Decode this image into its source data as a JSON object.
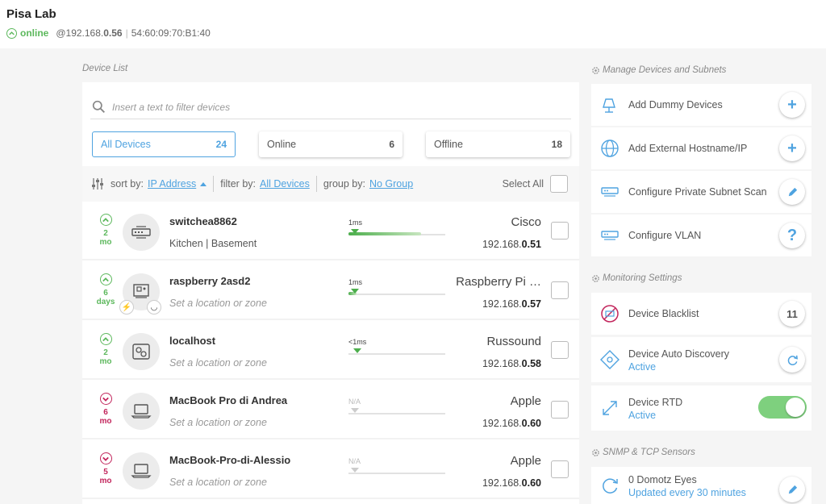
{
  "header": {
    "agent_name": "Pisa Lab",
    "status": "online",
    "ip_prefix": "@192.168.",
    "ip_suffix": "0.56",
    "mac": "54:60:09:70:B1:40"
  },
  "device_list": {
    "title": "Device List",
    "search_placeholder": "Insert a text to filter devices",
    "filters": [
      {
        "label": "All Devices",
        "count": "24"
      },
      {
        "label": "Online",
        "count": "6"
      },
      {
        "label": "Offline",
        "count": "18"
      }
    ],
    "toolbar": {
      "sort_label": "sort by:",
      "sort_value": "IP Address",
      "filter_label": "filter by:",
      "filter_value": "All Devices",
      "group_label": "group by:",
      "group_value": "No Group",
      "select_all": "Select All"
    },
    "devices": [
      {
        "status": "up",
        "age_value": "2",
        "age_unit": "mo",
        "name": "switchea8862",
        "location": "Kitchen | Basement",
        "latency": "1ms",
        "vendor": "Cisco",
        "ip_prefix": "192.168.",
        "ip_suffix": "0.51",
        "icon": "switch-icon"
      },
      {
        "status": "up",
        "age_value": "6",
        "age_unit": "days",
        "name": "raspberry 2asd2",
        "location": "Set a location or zone",
        "latency": "1ms",
        "vendor": "Raspberry Pi …",
        "ip_prefix": "192.168.",
        "ip_suffix": "0.57",
        "icon": "circuit-board-icon"
      },
      {
        "status": "up",
        "age_value": "2",
        "age_unit": "mo",
        "name": "localhost",
        "location": "Set a location or zone",
        "latency": "<1ms",
        "vendor": "Russound",
        "ip_prefix": "192.168.",
        "ip_suffix": "0.58",
        "icon": "gears-device-icon"
      },
      {
        "status": "down",
        "age_value": "6",
        "age_unit": "mo",
        "name": "MacBook Pro di Andrea",
        "location": "Set a location or zone",
        "latency": "N/A",
        "vendor": "Apple",
        "ip_prefix": "192.168.",
        "ip_suffix": "0.60",
        "icon": "laptop-icon"
      },
      {
        "status": "down",
        "age_value": "5",
        "age_unit": "mo",
        "name": "MacBook-Pro-di-Alessio",
        "location": "Set a location or zone",
        "latency": "N/A",
        "vendor": "Apple",
        "ip_prefix": "192.168.",
        "ip_suffix": "0.60",
        "icon": "laptop-icon"
      }
    ]
  },
  "manage": {
    "title": "Manage Devices and Subnets",
    "items": [
      {
        "label": "Add Dummy Devices",
        "icon": "lamp-icon",
        "action": "+"
      },
      {
        "label": "Add External Hostname/IP",
        "icon": "globe-icon",
        "action": "+"
      },
      {
        "label": "Configure Private Subnet Scan",
        "icon": "network-icon",
        "action": "edit"
      },
      {
        "label": "Configure VLAN",
        "icon": "network-icon",
        "action": "?"
      }
    ]
  },
  "monitoring": {
    "title": "Monitoring Settings",
    "blacklist": {
      "label": "Device Blacklist",
      "count": "11"
    },
    "discovery": {
      "label": "Device Auto Discovery",
      "status": "Active"
    },
    "rtd": {
      "label": "Device RTD",
      "status": "Active"
    }
  },
  "snmp": {
    "title": "SNMP & TCP Sensors",
    "label": "0 Domotz Eyes",
    "sub": "Updated every 30 minutes"
  },
  "colors": {
    "accent": "#4fa3e0",
    "online": "#5cb85c",
    "offline": "#c2255c"
  }
}
